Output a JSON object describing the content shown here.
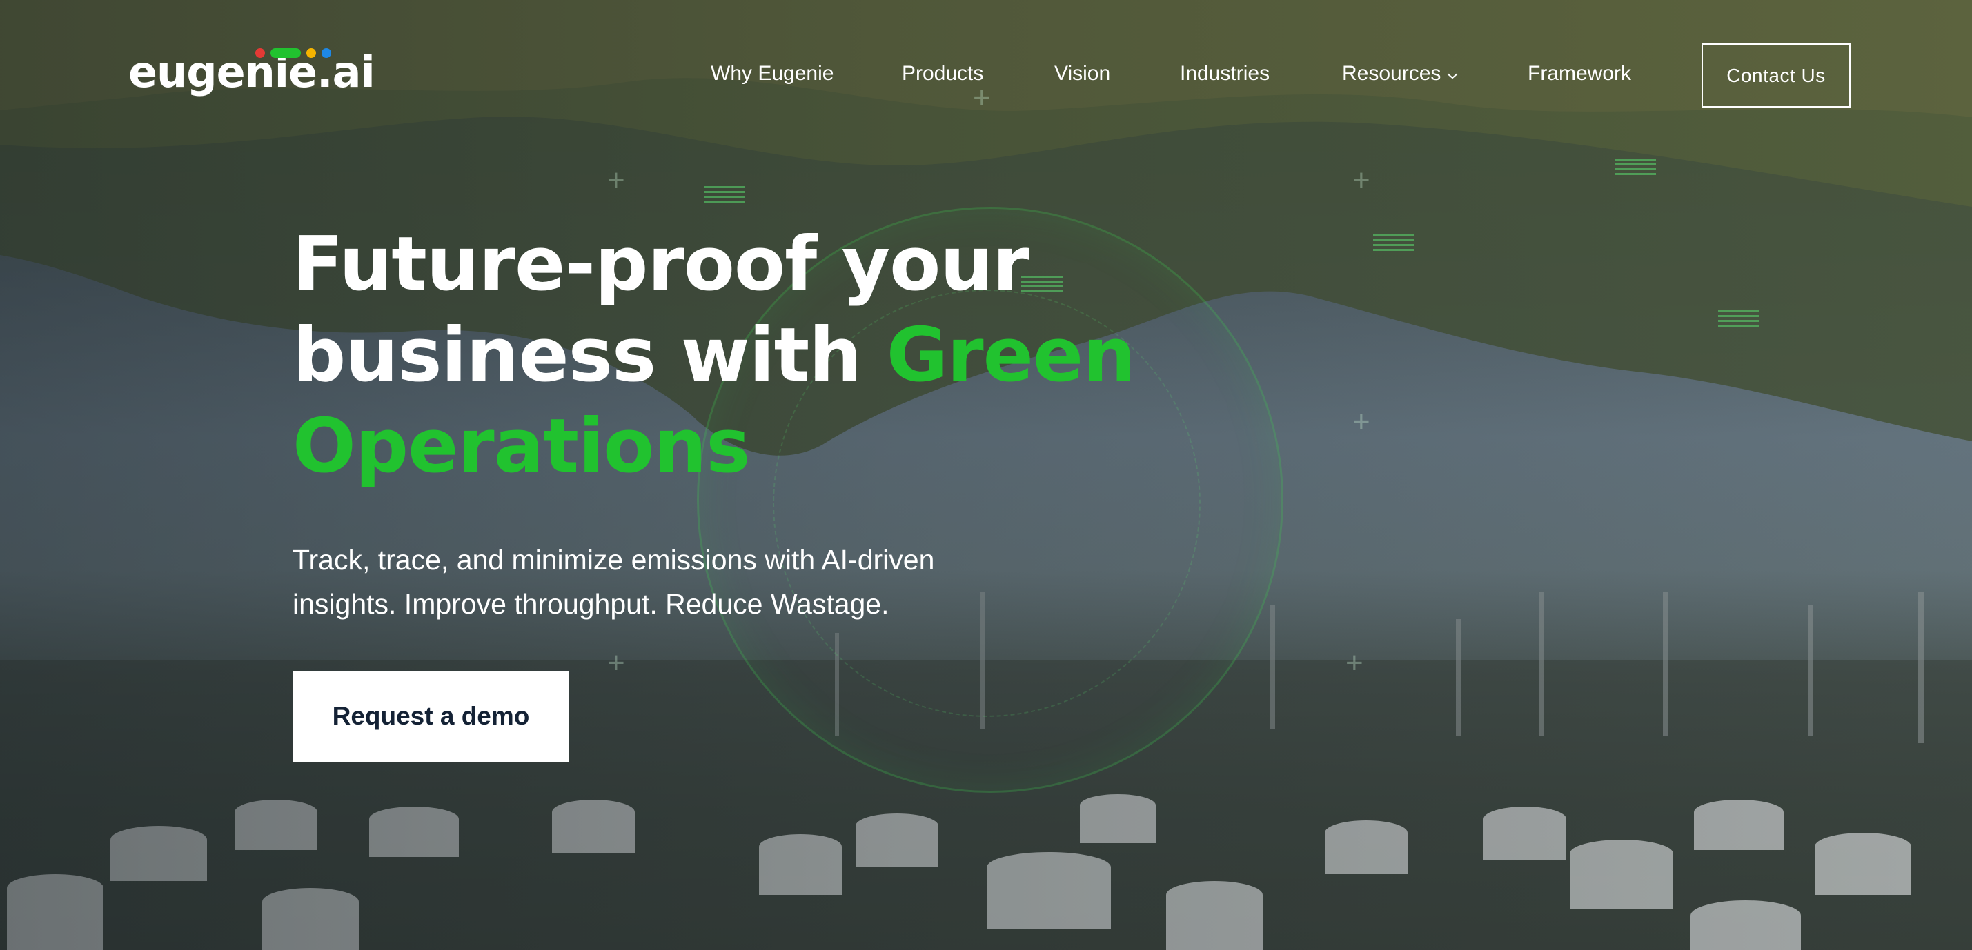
{
  "brand": {
    "name": "eugenie.ai",
    "dot_colors": [
      "#e53935",
      "#21c22f",
      "#f5b400",
      "#1e88e5"
    ]
  },
  "nav": {
    "items": [
      {
        "label": "Why Eugenie"
      },
      {
        "label": "Products"
      },
      {
        "label": "Vision"
      },
      {
        "label": "Industries"
      },
      {
        "label": "Resources",
        "icon": "chevron-down-icon"
      },
      {
        "label": "Framework"
      }
    ],
    "contact_label": "Contact Us"
  },
  "hero": {
    "headline_part1": "Future-proof your business with",
    "headline_highlight": "Green Operations",
    "subtitle": "Track, trace, and minimize emissions with AI-driven insights. Improve throughput. Reduce Wastage.",
    "cta_label": "Request a demo"
  },
  "colors": {
    "accent_green": "#21c22f",
    "cta_text": "#142235"
  }
}
